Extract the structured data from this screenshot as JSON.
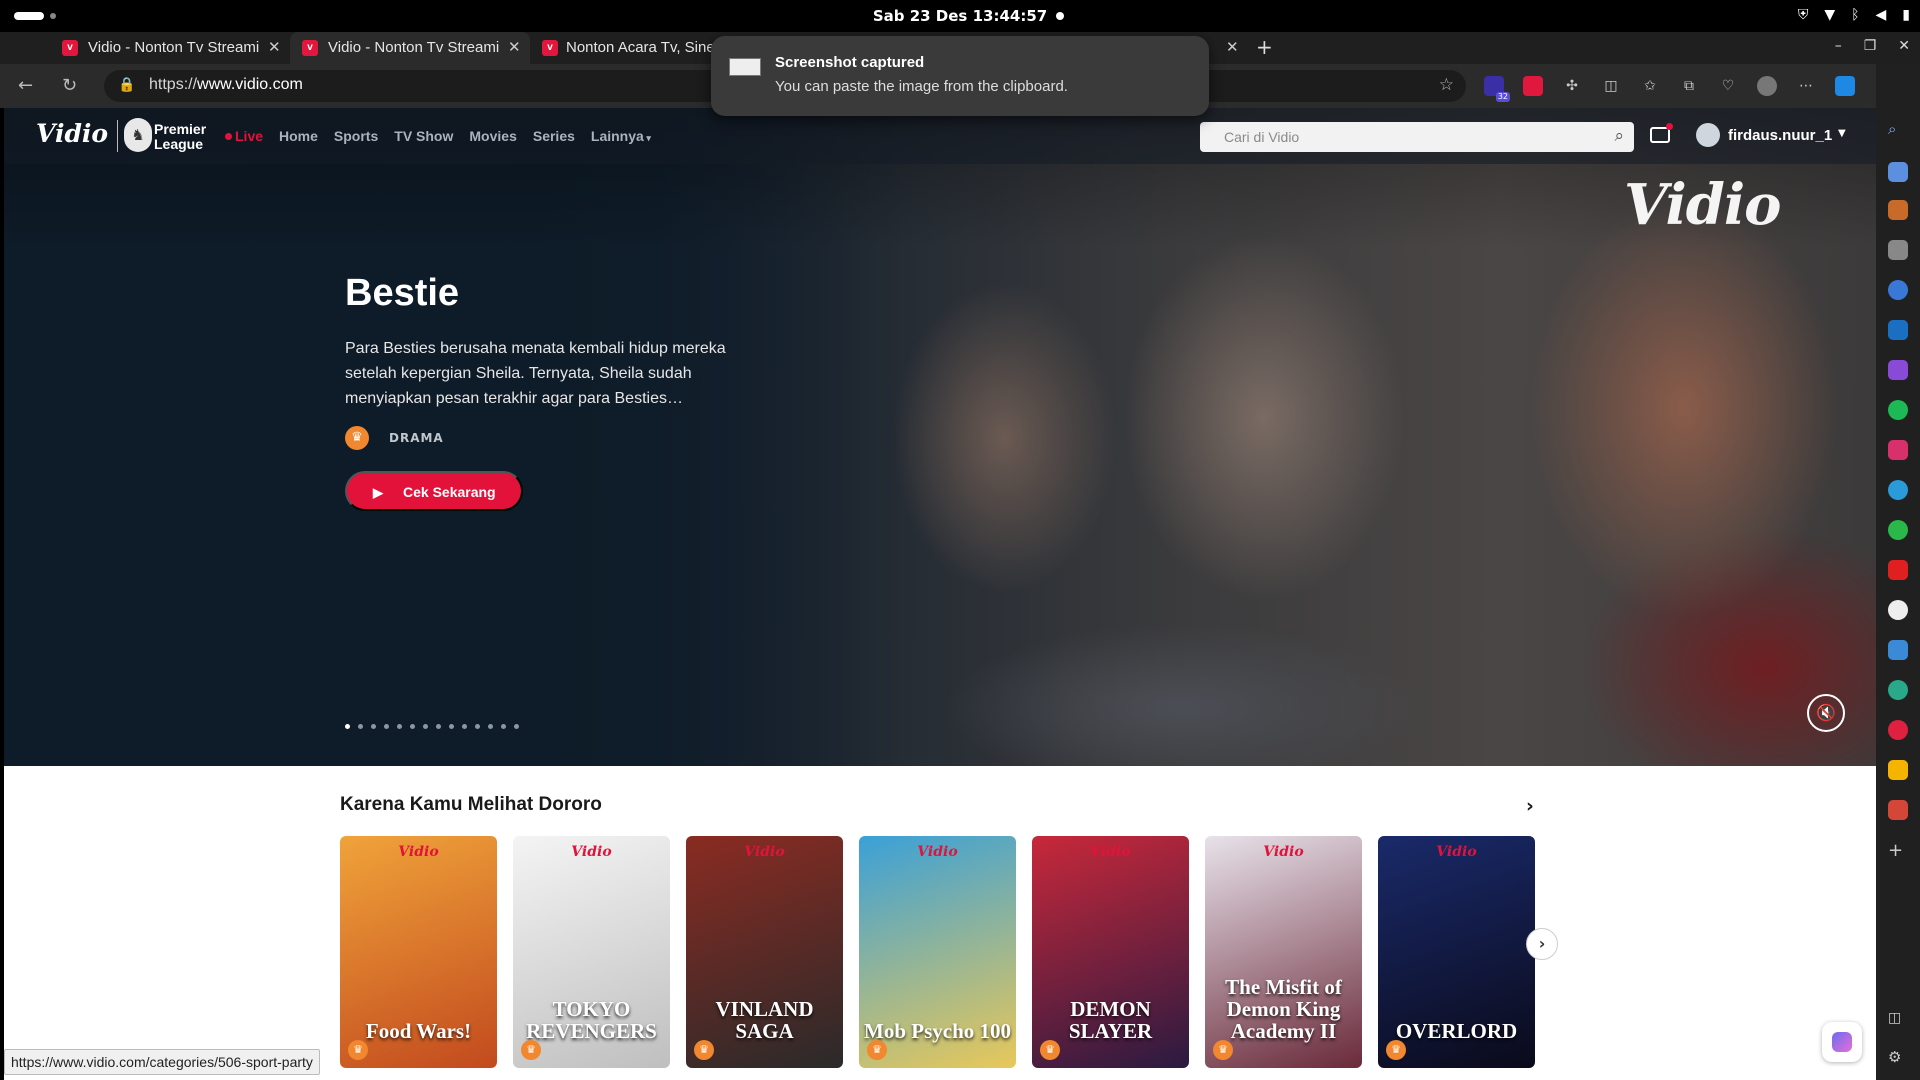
{
  "system": {
    "clock": "Sab 23 Des  13:44:57"
  },
  "browser": {
    "tabs": [
      {
        "title": "Vidio - Nonton Tv Streami"
      },
      {
        "title": "Vidio - Nonton Tv Streami"
      },
      {
        "title": "Nonton Acara Tv, Sinetron"
      }
    ],
    "url_prefix": "https://",
    "url_host": "www.vidio.com",
    "extension_badge": "32",
    "status_url": "https://www.vidio.com/categories/506-sport-party"
  },
  "notification": {
    "title": "Screenshot captured",
    "body": "You can paste the image from the clipboard."
  },
  "site": {
    "logo": "Vidio",
    "partner": [
      "Premier",
      "League"
    ],
    "nav": [
      "Live",
      "Home",
      "Sports",
      "TV Show",
      "Movies",
      "Series",
      "Lainnya"
    ],
    "search_placeholder": "Cari di Vidio",
    "username": "firdaus.nuur_1"
  },
  "hero": {
    "watermark": "Vidio",
    "title": "Bestie",
    "description": "Para Besties berusaha menata kembali hidup mereka setelah kepergian Sheila. Ternyata, Sheila sudah menyiapkan pesan terakhir agar para Besties…",
    "genre": "DRAMA",
    "cta": "Cek Sekarang",
    "slide_count": 14,
    "active_slide": 1
  },
  "recommendations": {
    "title": "Karena Kamu Melihat Dororo",
    "cards": [
      {
        "title": "Food Wars!",
        "colors": [
          "#f0a33a",
          "#c24a1e"
        ]
      },
      {
        "title": "TOKYO REVENGERS",
        "colors": [
          "#f4f4f4",
          "#bfbfbf"
        ]
      },
      {
        "title": "VINLAND SAGA",
        "colors": [
          "#8a2b22",
          "#2a2a2a"
        ]
      },
      {
        "title": "Mob Psycho 100",
        "colors": [
          "#3aa0d8",
          "#e8c85a"
        ]
      },
      {
        "title": "DEMON SLAYER",
        "colors": [
          "#c8283a",
          "#2a1a40"
        ]
      },
      {
        "title": "The Misfit of Demon King Academy II",
        "colors": [
          "#e8e2ea",
          "#6a2a3a"
        ]
      },
      {
        "title": "OVERLORD",
        "colors": [
          "#1a2a6a",
          "#0a0a1a"
        ]
      }
    ]
  }
}
